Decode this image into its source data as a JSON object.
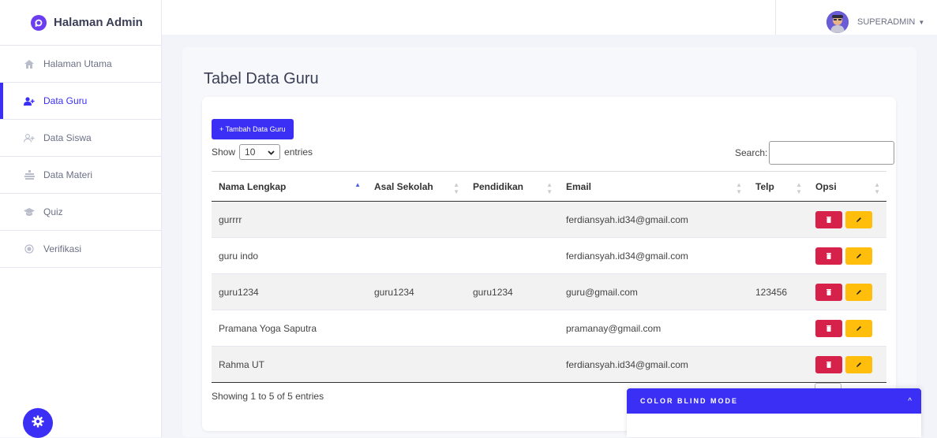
{
  "sidebar": {
    "brand": "Halaman Admin",
    "items": [
      {
        "label": "Halaman Utama",
        "icon": "home-icon"
      },
      {
        "label": "Data Guru",
        "icon": "user-plus-icon",
        "active": true
      },
      {
        "label": "Data Siswa",
        "icon": "users-icon"
      },
      {
        "label": "Data Materi",
        "icon": "book-icon"
      },
      {
        "label": "Quiz",
        "icon": "graduation-cap-icon"
      },
      {
        "label": "Verifikasi",
        "icon": "check-circle-icon"
      }
    ]
  },
  "topbar": {
    "user_name": "SUPERADMIN",
    "caret": "▼"
  },
  "page": {
    "title": "Tabel Data Guru"
  },
  "controls": {
    "add_button": "+ Tambah Data Guru",
    "show_label": "Show",
    "entries_value": "10",
    "entries_suffix": "entries",
    "search_label": "Search:"
  },
  "table": {
    "columns": [
      "Nama Lengkap",
      "Asal Sekolah",
      "Pendidikan",
      "Email",
      "Telp",
      "Opsi"
    ],
    "rows": [
      {
        "nama": "gurrrr",
        "asal": "",
        "pendidikan": "",
        "email": "ferdiansyah.id34@gmail.com",
        "telp": ""
      },
      {
        "nama": "guru indo",
        "asal": "",
        "pendidikan": "",
        "email": "ferdiansyah.id34@gmail.com",
        "telp": ""
      },
      {
        "nama": "guru1234",
        "asal": "guru1234",
        "pendidikan": "guru1234",
        "email": "guru@gmail.com",
        "telp": "123456"
      },
      {
        "nama": "Pramana Yoga Saputra",
        "asal": "",
        "pendidikan": "",
        "email": "pramanay@gmail.com",
        "telp": ""
      },
      {
        "nama": "Rahma UT",
        "asal": "",
        "pendidikan": "",
        "email": "ferdiansyah.id34@gmail.com",
        "telp": ""
      }
    ],
    "info": "Showing 1 to 5 of 5 entries"
  },
  "color_blind": {
    "title": "COLOR BLIND MODE",
    "toggle": "^"
  },
  "colors": {
    "accent": "#3b2ff5",
    "delete": "#d6214a",
    "edit": "#ffbe0b"
  }
}
